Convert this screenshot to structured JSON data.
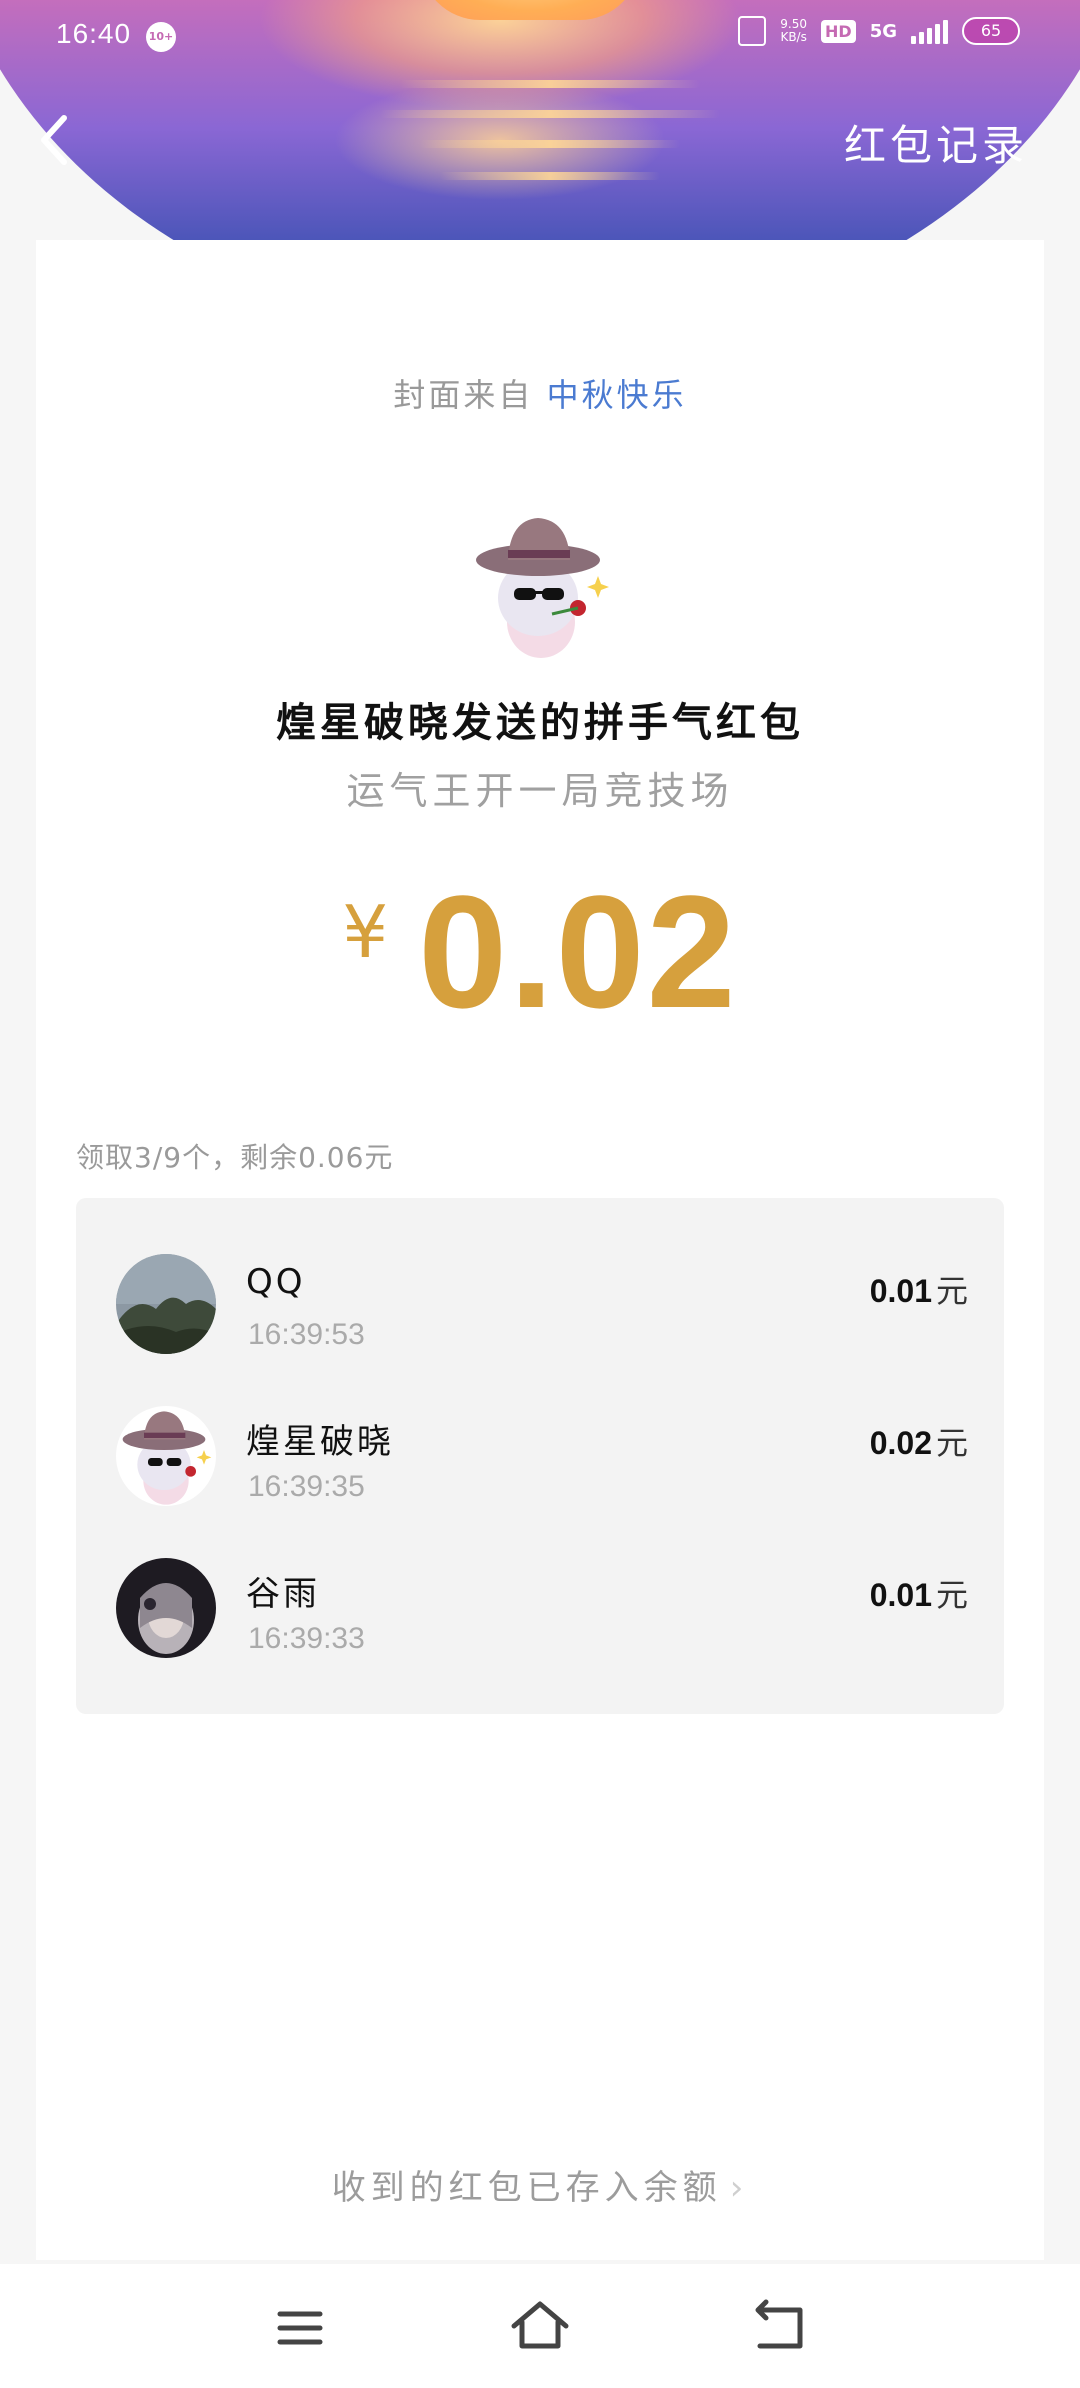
{
  "status_bar": {
    "time": "16:40",
    "notification_badge": "10+",
    "net_speed_value": "9.50",
    "net_speed_unit": "KB/s",
    "hd_label": "HD",
    "network": "5G",
    "battery": "65"
  },
  "header": {
    "back_icon": "chevron-left-icon",
    "record_link": "红包记录"
  },
  "cover": {
    "prefix": "封面来自 ",
    "name": "中秋快乐"
  },
  "packet": {
    "title": "煌星破晓发送的拼手气红包",
    "subtitle": "运气王开一局竞技场",
    "currency": "¥",
    "amount": "0.02"
  },
  "summary": "领取3/9个，剩余0.06元",
  "recipients": [
    {
      "name": "QQ",
      "time": "16:39:53",
      "amount": "0.01",
      "unit": "元",
      "avatar": "landscape-avatar"
    },
    {
      "name": "煌星破晓",
      "time": "16:39:35",
      "amount": "0.02",
      "unit": "元",
      "avatar": "anime-hat-avatar"
    },
    {
      "name": "谷雨",
      "time": "16:39:33",
      "amount": "0.01",
      "unit": "元",
      "avatar": "dark-anime-avatar"
    }
  ],
  "footer_link": "收到的红包已存入余额",
  "footer_chevron": "›",
  "navbar": {
    "icons": [
      "menu-icon",
      "home-icon",
      "back-icon"
    ]
  },
  "colors": {
    "amount": "#d6a03d",
    "cover_link": "#4b7bd1",
    "banner_pink": "#d677c3",
    "banner_blue": "#3b4aa6"
  }
}
